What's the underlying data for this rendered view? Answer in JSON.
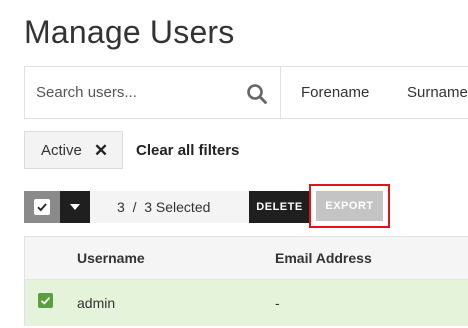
{
  "page": {
    "title": "Manage Users"
  },
  "search": {
    "placeholder": "Search users...",
    "fields": [
      "Forename",
      "Surname"
    ]
  },
  "filters": {
    "active_chip": "Active",
    "chip_close": "✕",
    "clear_label": "Clear all filters"
  },
  "bulk_actions": {
    "selected_text": "3  /  3 Selected",
    "delete_label": "DELETE",
    "export_label": "EXPORT"
  },
  "table": {
    "columns": [
      "Username",
      "Email Address"
    ],
    "rows": [
      {
        "username": "admin",
        "email": "-",
        "selected": true
      }
    ]
  },
  "colors": {
    "highlight_border": "#e0151b",
    "selected_row": "#e5f3da",
    "checkbox_green": "#5aa03c",
    "dark_button": "#1f1f1f",
    "disabled_button": "#c4c4c4"
  }
}
